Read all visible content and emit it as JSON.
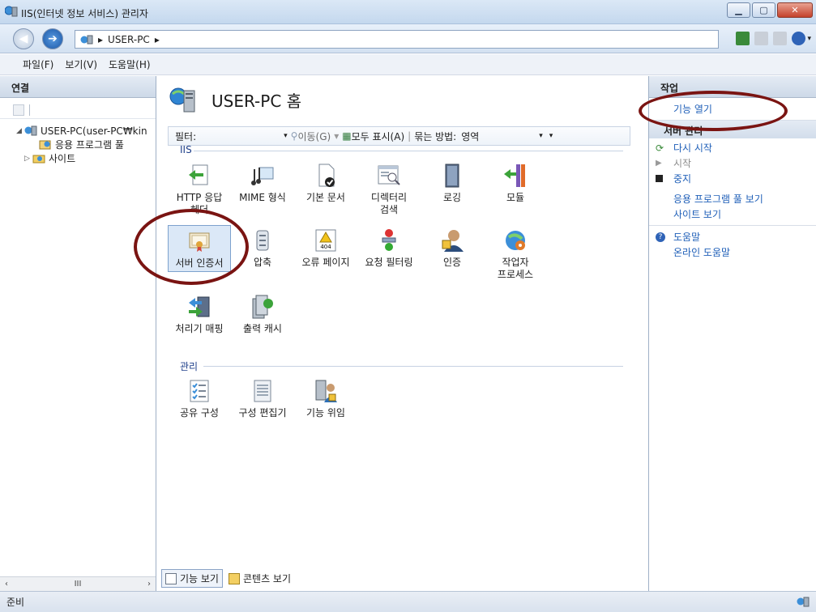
{
  "window": {
    "title": "IIS(인터넷 정보 서비스) 관리자"
  },
  "address": {
    "crumbs": [
      "USER-PC"
    ]
  },
  "menu": [
    "파일(F)",
    "보기(V)",
    "도움말(H)"
  ],
  "left": {
    "header": "연결",
    "tree": [
      {
        "label": "USER-PC(user-PC₩kin",
        "depth": 0
      },
      {
        "label": "응용 프로그램 풀",
        "depth": 1
      },
      {
        "label": "사이트",
        "depth": 1
      }
    ],
    "scroll_mark": "III"
  },
  "center": {
    "title": "USER-PC 홈",
    "filter": {
      "label": "필터:",
      "go_label": "이동(G)",
      "show_all_label": "모두 표시(A)",
      "group_by_label": "묶는 방법:",
      "group_by_value": "영역"
    },
    "groups": [
      {
        "label": "IIS"
      },
      {
        "label": "관리"
      }
    ],
    "iis_features": [
      [
        "HTTP 응답",
        "헤더"
      ],
      [
        "MIME 형식"
      ],
      [
        "기본 문서"
      ],
      [
        "디렉터리",
        "검색"
      ],
      [
        "로깅"
      ],
      [
        "모듈"
      ],
      [
        "서버 인증서"
      ],
      [
        "압축"
      ],
      [
        "오류 페이지"
      ],
      [
        "요청 필터링"
      ],
      [
        "인증"
      ],
      [
        "작업자",
        "프로세스"
      ],
      [
        "처리기 매핑"
      ],
      [
        "출력 캐시"
      ]
    ],
    "mgmt_features": [
      [
        "공유 구성"
      ],
      [
        "구성 편집기"
      ],
      [
        "기능 위임"
      ]
    ],
    "tabs": [
      "기능 보기",
      "콘텐츠 보기"
    ]
  },
  "right": {
    "header": "작업",
    "open_feature": "기능 열기",
    "server_manage_heading": "서버 관리",
    "restart": "다시 시작",
    "start": "시작",
    "stop": "중지",
    "view_app_pools": "응용 프로그램 풀 보기",
    "view_sites": "사이트 보기",
    "help": "도움말",
    "online_help": "온라인 도움말"
  },
  "status": {
    "text": "준비"
  }
}
